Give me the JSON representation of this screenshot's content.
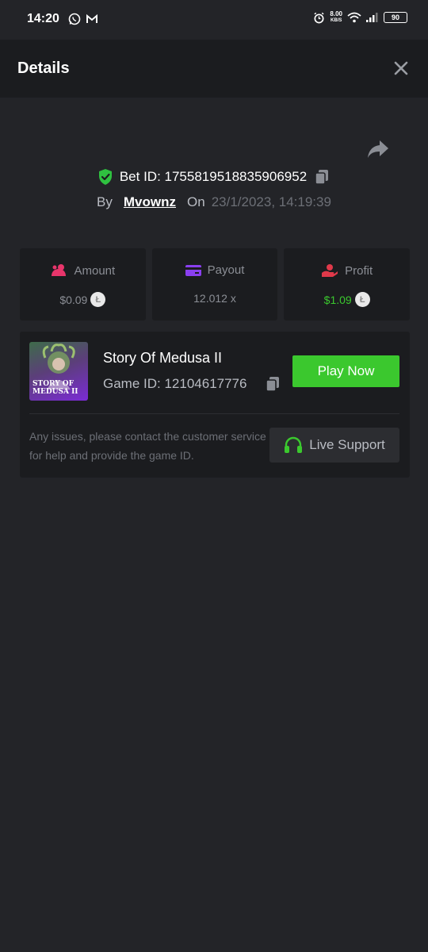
{
  "status_bar": {
    "time": "14:20",
    "speed_value": "8.00",
    "speed_unit": "KB/S",
    "battery": "90",
    "icons": [
      "whatsapp-icon",
      "gmail-icon",
      "alarm-icon",
      "wifi-icon",
      "signal-icon",
      "battery-icon"
    ]
  },
  "header": {
    "title": "Details",
    "close_icon": "close-icon"
  },
  "bet": {
    "id_label": "Bet ID: 1755819518835906952",
    "by_label": "By",
    "user": "Mvownz",
    "on_label": "On",
    "date": "23/1/2023, 14:19:39"
  },
  "stats": {
    "amount": {
      "label": "Amount",
      "value": "$0.09",
      "coin": "Ł"
    },
    "payout": {
      "label": "Payout",
      "value": "12.012 x"
    },
    "profit": {
      "label": "Profit",
      "value": "$1.09",
      "coin": "Ł"
    }
  },
  "game": {
    "name": "Story Of Medusa II",
    "id_label": "Game ID: 12104617776",
    "thumb_line1": "STORY OF",
    "thumb_line2": "MEDUSA II",
    "play_label": "Play Now",
    "help_text": "Any issues, please contact the customer service for help and provide the game ID.",
    "support_label": "Live Support"
  },
  "colors": {
    "background": "#232428",
    "card": "#1b1c1f",
    "accent_green": "#3bc82e",
    "amount_icon": "#e8356b",
    "payout_icon": "#8a3ff0",
    "profit_icon": "#e0394a"
  }
}
